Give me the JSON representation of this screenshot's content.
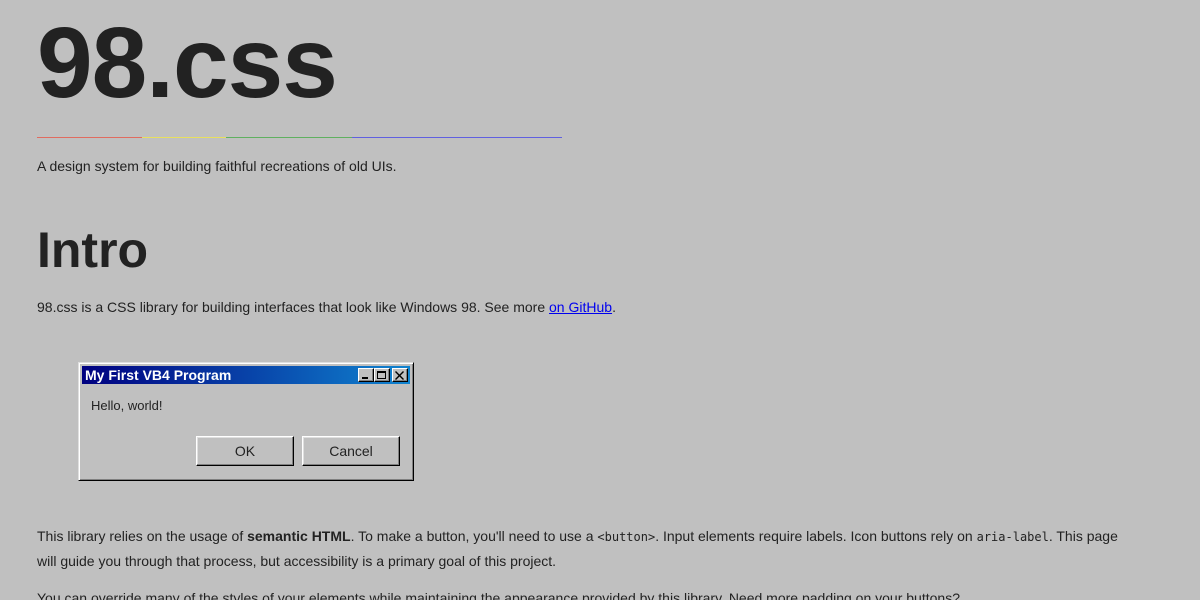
{
  "header": {
    "title": "98.css",
    "tagline": "A design system for building faithful recreations of old UIs."
  },
  "rainbow_colors": [
    "#e06c60",
    "#e8e060",
    "#60b060",
    "#6060e0"
  ],
  "intro": {
    "title": "Intro",
    "text_before_link": "98.css is a CSS library for building interfaces that look like Windows 98. See more ",
    "link_text": "on GitHub",
    "text_after_link": "."
  },
  "demo_window": {
    "title": "My First VB4 Program",
    "message": "Hello, world!",
    "ok_label": "OK",
    "cancel_label": "Cancel",
    "controls": [
      "minimize-icon",
      "maximize-icon",
      "close-icon"
    ]
  },
  "paragraph1": {
    "part1": "This library relies on the usage of ",
    "bold": "semantic HTML",
    "part2": ". To make a button, you'll need to use a ",
    "code1": "<button>",
    "part3": ". Input elements require labels. Icon buttons rely on ",
    "code2": "aria-label",
    "part4": ". This page will guide you through that process, but accessibility is a primary goal of this project."
  },
  "paragraph2": {
    "text": "You can override many of the styles of your elements while maintaining the appearance provided by this library. Need more padding on your buttons?"
  }
}
